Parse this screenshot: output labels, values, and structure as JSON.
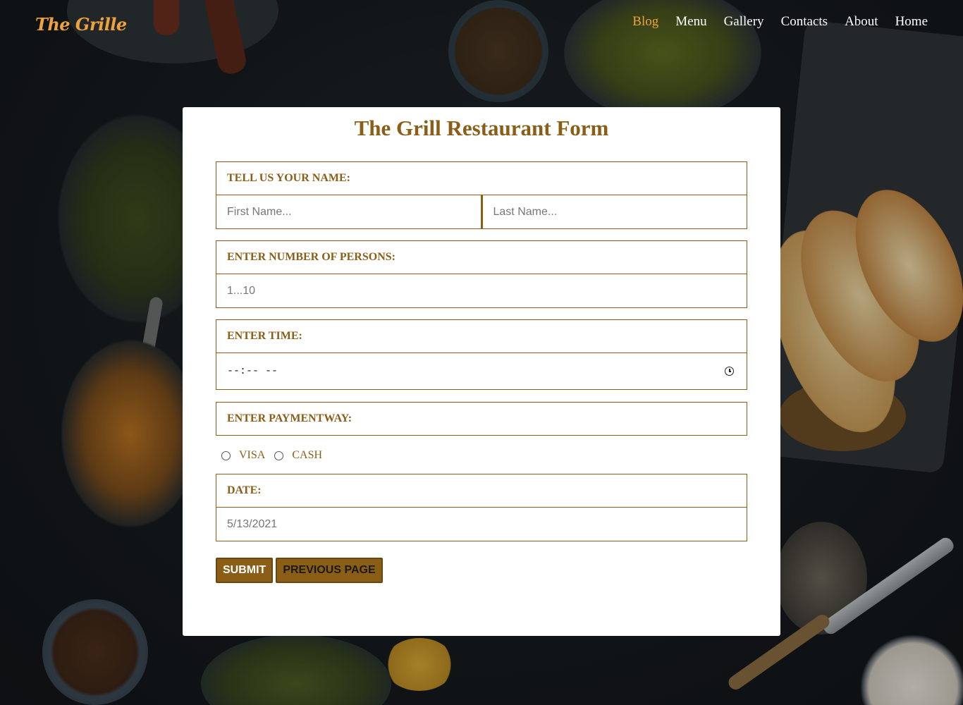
{
  "brand": {
    "logo": "The Grille"
  },
  "nav": {
    "items": [
      {
        "label": "Blog",
        "active": true
      },
      {
        "label": "Menu",
        "active": false
      },
      {
        "label": "Gallery",
        "active": false
      },
      {
        "label": "Contacts",
        "active": false
      },
      {
        "label": "About",
        "active": false
      },
      {
        "label": "Home",
        "active": false
      }
    ]
  },
  "form": {
    "title": "The Grill Restaurant Form",
    "name": {
      "label": "TELL US YOUR NAME:",
      "first_placeholder": "First Name...",
      "last_placeholder": "Last Name..."
    },
    "persons": {
      "label": "ENTER NUMBER OF PERSONS:",
      "placeholder": "1...10"
    },
    "time": {
      "label": "ENTER TIME:",
      "value": "--:-- --"
    },
    "payment": {
      "label": "ENTER PAYMENTWAY:",
      "options": [
        "VISA",
        "CASH"
      ]
    },
    "date": {
      "label": "DATE:",
      "value": "5/13/2021"
    },
    "buttons": {
      "submit": "SUBMIT",
      "previous": "PREVIOUS PAGE"
    }
  },
  "colors": {
    "accent": "#8b5e17",
    "nav_active": "#f0a23a",
    "nav_text": "#ffffff"
  }
}
